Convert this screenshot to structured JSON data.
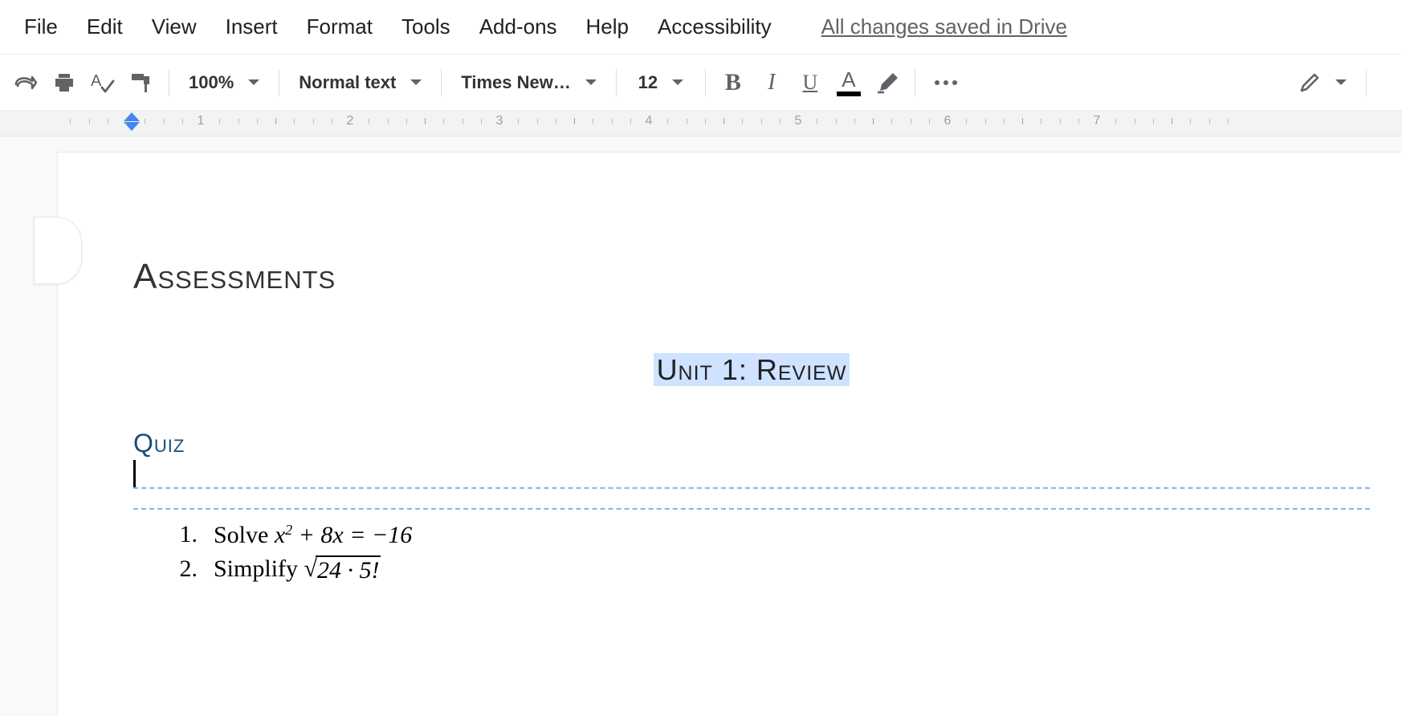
{
  "menu": {
    "items": [
      "File",
      "Edit",
      "View",
      "Insert",
      "Format",
      "Tools",
      "Add-ons",
      "Help",
      "Accessibility"
    ],
    "save_status": "All changes saved in Drive"
  },
  "toolbar": {
    "zoom": "100%",
    "style": "Normal text",
    "font": "Times New…",
    "size": "12"
  },
  "ruler": {
    "numbers": [
      "1",
      "2",
      "3",
      "4",
      "5",
      "6",
      "7"
    ]
  },
  "document": {
    "title": "Assessments",
    "subtitle": "Unit 1: Review",
    "heading2": "Quiz",
    "items": [
      {
        "n": "1.",
        "label": "Solve ",
        "math": "x² + 8x = −16",
        "plain": "x^2 + 8x = -16"
      },
      {
        "n": "2.",
        "label": "Simplify ",
        "math": "√24 · 5!",
        "plain": "sqrt(24 * 5!)"
      }
    ]
  }
}
